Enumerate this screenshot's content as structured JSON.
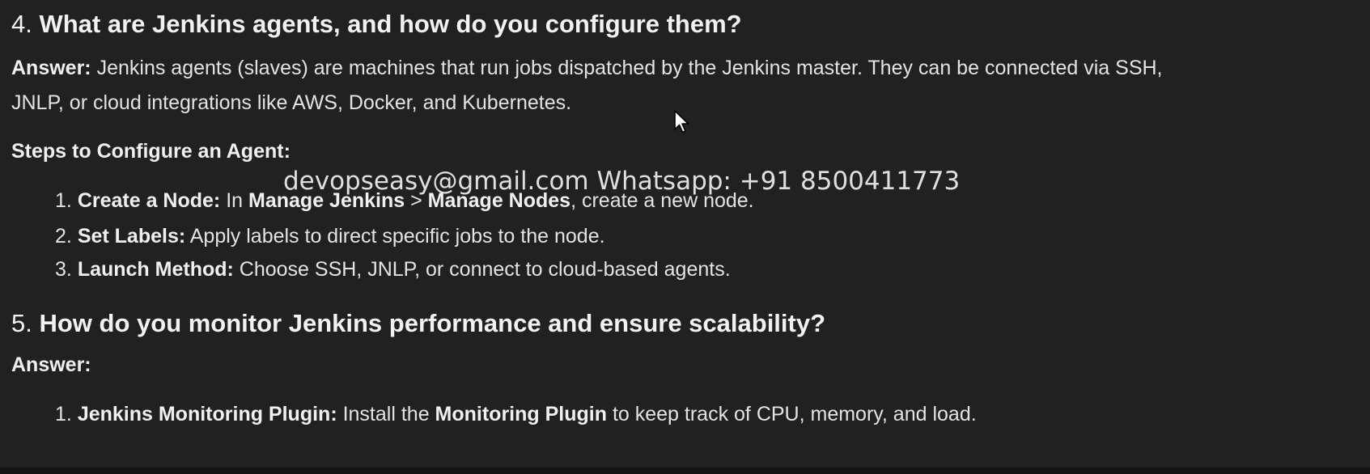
{
  "question4": {
    "number": "4.",
    "text": "What are Jenkins agents, and how do you configure them?",
    "answer_label": "Answer:",
    "answer_line1": " Jenkins agents (slaves) are machines that run jobs dispatched by the Jenkins master. They can be connected via SSH,",
    "answer_line2": "JNLP, or cloud integrations like AWS, Docker, and Kubernetes.",
    "steps_heading": "Steps to Configure an Agent:",
    "steps": [
      {
        "num": "1.",
        "label": "Create a Node:",
        "pre": " In ",
        "bold1": "Manage Jenkins",
        "mid": " > ",
        "bold2": "Manage Nodes",
        "post": ", create a new node."
      },
      {
        "num": "2.",
        "label": "Set Labels:",
        "text": " Apply labels to direct specific jobs to the node."
      },
      {
        "num": "3.",
        "label": "Launch Method:",
        "text": " Choose SSH, JNLP, or connect to cloud-based agents."
      }
    ]
  },
  "question5": {
    "number": "5.",
    "text": "How do you monitor Jenkins performance and ensure scalability?",
    "answer_label": "Answer:",
    "steps": [
      {
        "num": "1.",
        "label": "Jenkins Monitoring Plugin:",
        "pre": " Install the ",
        "bold1": "Monitoring Plugin",
        "post": " to keep track of CPU, memory, and load."
      }
    ]
  },
  "watermark": {
    "text": "devopseasy@gmail.com Whatsapp: +91 8500411773"
  },
  "icons": {
    "cursor": "mouse-pointer-icon"
  },
  "colors": {
    "background": "#212121",
    "text": "#ececec"
  }
}
